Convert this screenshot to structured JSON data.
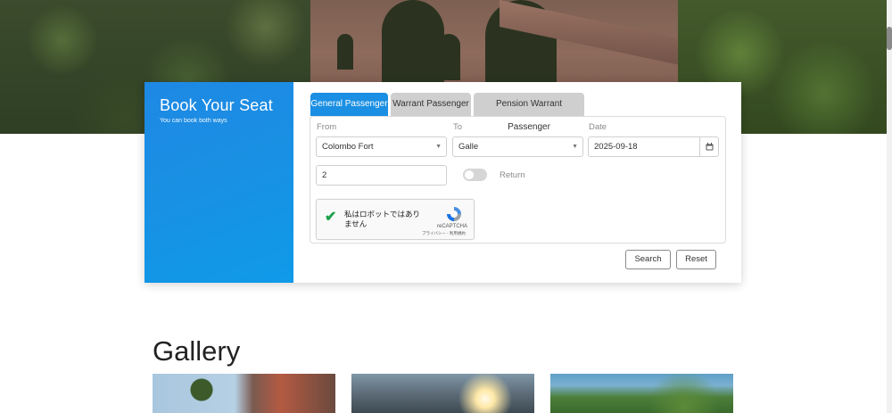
{
  "booking": {
    "title": "Book Your Seat",
    "subtitle": "You can book both ways",
    "tabs": [
      {
        "label": "General Passenger",
        "active": true
      },
      {
        "label": "Warrant Passenger",
        "active": false
      },
      {
        "label": "Pension Warrant Passenger",
        "active": false
      }
    ],
    "from": {
      "label": "From",
      "value": "Colombo Fort"
    },
    "to": {
      "label": "To",
      "value": "Galle"
    },
    "date": {
      "label": "Date",
      "value": "2025-09-18"
    },
    "passengers": {
      "value": "2"
    },
    "return_toggle": {
      "label": "Return",
      "on": false
    },
    "captcha": {
      "text": "私はロボットではありません",
      "brand": "reCAPTCHA",
      "links": "プライバシー - 利用規約",
      "checked": true
    },
    "buttons": {
      "search": "Search",
      "reset": "Reset"
    }
  },
  "gallery": {
    "title": "Gallery"
  },
  "colors": {
    "accent": "#1a8fe3",
    "tab_inactive": "#cfcfcf",
    "captcha_check": "#1fa14a"
  },
  "icons": {
    "calendar": "calendar-icon",
    "dropdown": "chevron-down-icon",
    "captcha_logo": "recaptcha-logo-icon",
    "check": "check-icon"
  }
}
